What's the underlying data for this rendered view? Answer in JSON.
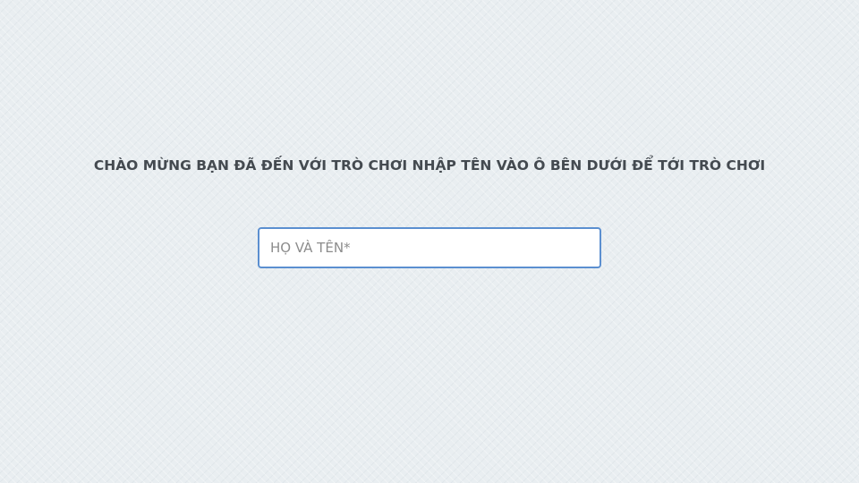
{
  "welcome": {
    "text": "CHÀO MỪNG BẠN ĐÃ ĐẾN VỚI TRÒ CHƠI NHẬP TÊN VÀO Ô BÊN DƯỚI ĐỂ TỚI TRÒ CHƠI"
  },
  "name_input": {
    "placeholder": "HỌ VÀ TÊN*",
    "value": ""
  },
  "colors": {
    "background": "#e9eef1",
    "input_border": "#5b8fd0",
    "text": "#444a50"
  }
}
